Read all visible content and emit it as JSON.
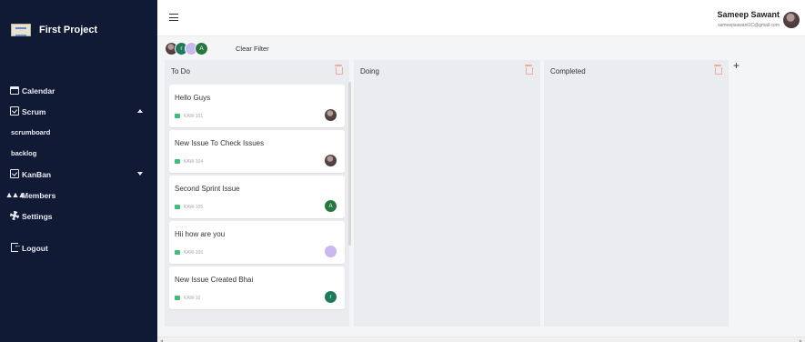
{
  "brand": {
    "name": "First Project",
    "logo_icon": "building-logo-icon"
  },
  "sidebar": {
    "items": [
      {
        "label": "Calendar",
        "icon": "calendar-icon"
      },
      {
        "label": "Scrum",
        "icon": "checkbox-icon",
        "expanded": true
      },
      {
        "label": "KanBan",
        "icon": "checkbox-icon",
        "expanded": false
      },
      {
        "label": "Members",
        "icon": "members-icon"
      },
      {
        "label": "Settings",
        "icon": "gear-icon"
      },
      {
        "label": "Logout",
        "icon": "logout-icon"
      }
    ],
    "scrum_sub": [
      "scrumboard",
      "backlog"
    ]
  },
  "topbar": {
    "menu_icon": "hamburger-icon",
    "user_name": "Sameep Sawant",
    "user_email": "sameepsawant1C@gmail.com"
  },
  "filters": {
    "avatars": [
      "photo",
      "r",
      "person",
      "A"
    ],
    "clear_label": "Clear Filter"
  },
  "board": {
    "columns": [
      {
        "title": "To Do",
        "cards": [
          {
            "title": "Hello Guys",
            "key": "KAW-101",
            "assignee": "photo"
          },
          {
            "title": "New Issue To Check Issues",
            "key": "KAW-104",
            "assignee": "photo"
          },
          {
            "title": "Second Sprint Issue",
            "key": "KAW-105",
            "assignee": "A"
          },
          {
            "title": "Hii how are you",
            "key": "KAW-106",
            "assignee": "person"
          },
          {
            "title": "New Issue Created Bhai",
            "key": "KAW-10",
            "assignee": "r"
          }
        ]
      },
      {
        "title": "Doing",
        "cards": []
      },
      {
        "title": "Completed",
        "cards": []
      }
    ],
    "add_column_label": "+"
  },
  "colors": {
    "sidebar_bg": "#111a34",
    "column_bg": "#ebecf0",
    "flag_green": "#3dbf7a",
    "trash_red": "#f2a9a6"
  }
}
